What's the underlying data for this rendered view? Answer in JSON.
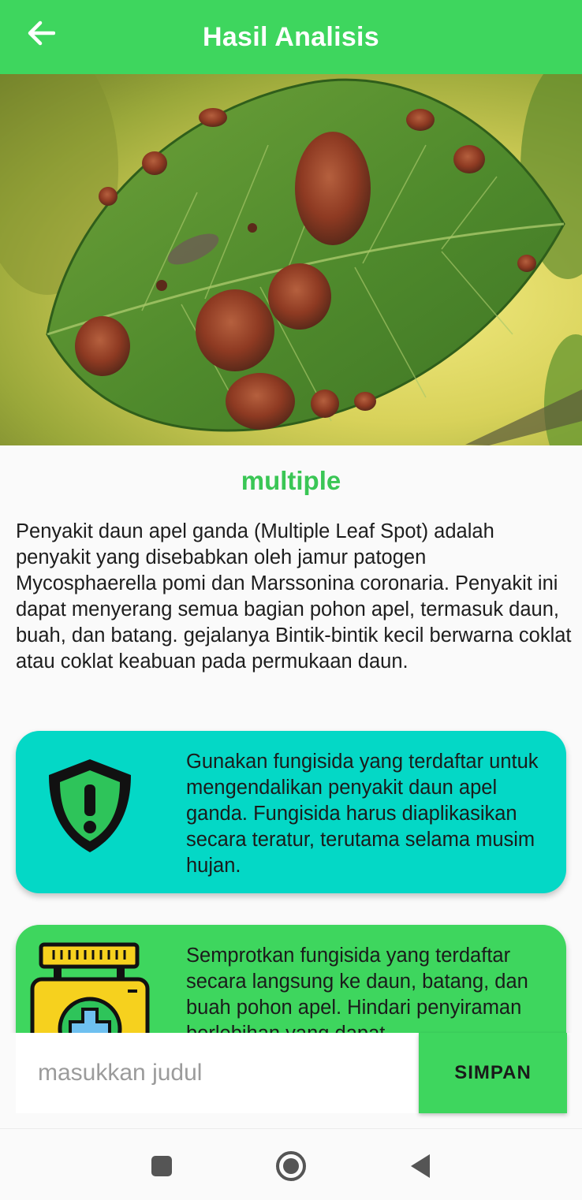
{
  "appbar": {
    "title": "Hasil Analisis",
    "back_icon": "arrow-left-icon",
    "color": "#3ed65e"
  },
  "hero": {
    "image": "apple-leaf-with-brown-spots-photo"
  },
  "result": {
    "name": "multiple",
    "description": "Penyakit daun apel ganda (Multiple Leaf Spot) adalah penyakit yang disebabkan oleh jamur patogen Mycosphaerella pomi dan Marssonina coronaria. Penyakit ini dapat menyerang semua bagian pohon apel, termasuk daun, buah, dan batang. gejalanya Bintik-bintik kecil berwarna coklat atau coklat keabuan pada permukaan daun."
  },
  "cards": [
    {
      "icon": "shield-exclamation-icon",
      "text": "Gunakan fungisida yang terdaftar untuk mengendalikan penyakit daun apel ganda. Fungisida harus diaplikasikan secara teratur, terutama selama musim hujan.",
      "color": "#04d8c6"
    },
    {
      "icon": "first-aid-kit-icon",
      "text": "Semprotkan fungisida yang terdaftar secara langsung ke daun, batang, dan buah pohon apel. Hindari penyiraman berlebihan yang dapat",
      "color": "#3ed65e"
    }
  ],
  "save_form": {
    "placeholder": "masukkan judul",
    "value": "",
    "button_label": "SIMPAN"
  },
  "navbar": {
    "items": [
      "recents-square-icon",
      "home-circle-icon",
      "back-triangle-icon"
    ]
  }
}
